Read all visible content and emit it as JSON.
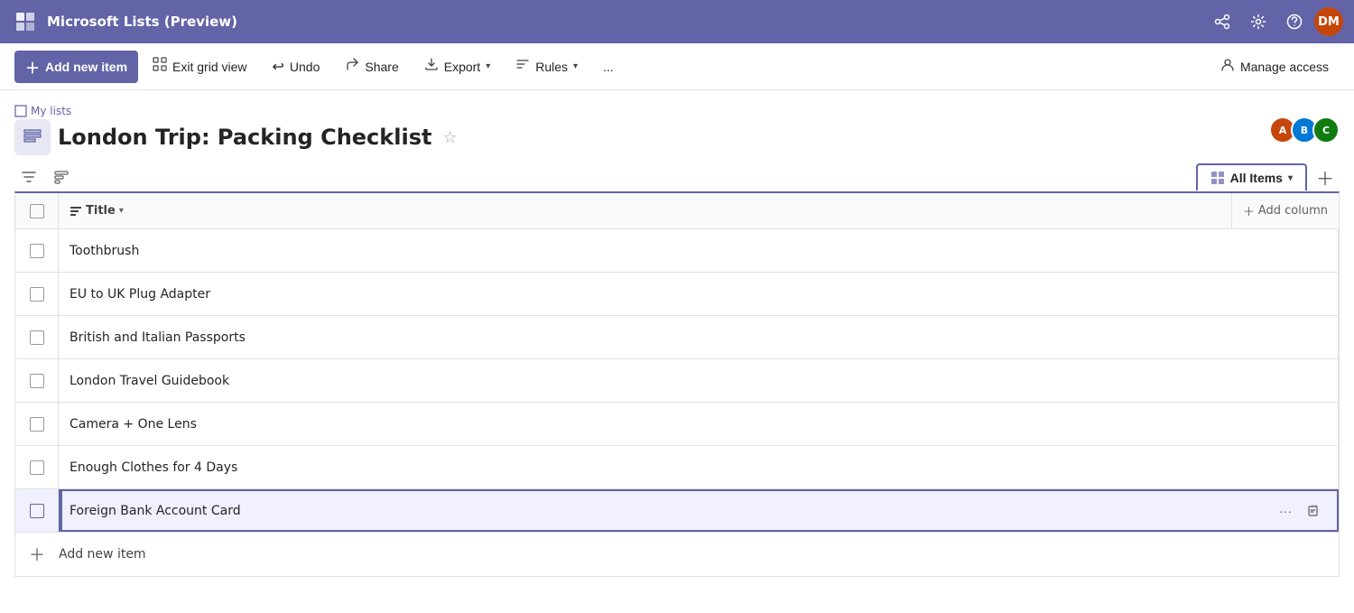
{
  "app": {
    "title": "Microsoft Lists (Preview)"
  },
  "topbar": {
    "logo_label": "Lists",
    "nav_icon": "grid-icon",
    "share_icon": "share-icon",
    "settings_icon": "settings-icon",
    "help_icon": "help-icon",
    "avatar_initials": "DM"
  },
  "commandbar": {
    "add_new_item": "Add new item",
    "exit_grid_view": "Exit grid view",
    "undo": "Undo",
    "share": "Share",
    "export": "Export",
    "rules": "Rules",
    "more": "...",
    "manage_access": "Manage access"
  },
  "header": {
    "breadcrumb": "My lists",
    "page_title": "London Trip: Packing Checklist",
    "member_avatars": [
      {
        "initials": "A",
        "color": "#c5460a"
      },
      {
        "initials": "B",
        "color": "#0078d4"
      },
      {
        "initials": "C",
        "color": "#107c10"
      }
    ]
  },
  "viewcontrols": {
    "filter_icon": "filter-icon",
    "group_icon": "group-icon",
    "all_items_label": "All Items",
    "chevron_icon": "chevron-down-icon",
    "add_view_icon": "add-icon"
  },
  "table": {
    "columns": [
      {
        "id": "title",
        "label": "Title",
        "icon": "title-icon"
      }
    ],
    "add_column_label": "Add column",
    "rows": [
      {
        "id": 1,
        "title": "Toothbrush",
        "selected": false
      },
      {
        "id": 2,
        "title": "EU to UK Plug Adapter",
        "selected": false
      },
      {
        "id": 3,
        "title": "British and Italian Passports",
        "selected": false
      },
      {
        "id": 4,
        "title": "London Travel Guidebook",
        "selected": false
      },
      {
        "id": 5,
        "title": "Camera + One Lens",
        "selected": false
      },
      {
        "id": 6,
        "title": "Enough Clothes for 4 Days",
        "selected": false
      },
      {
        "id": 7,
        "title": "Foreign Bank Account Card",
        "selected": true,
        "show_actions": true
      }
    ],
    "add_item_label": "Add new item"
  },
  "colors": {
    "accent": "#6264a7",
    "selected_row_bg": "#f0f0ff",
    "selected_border": "#6264a7"
  }
}
